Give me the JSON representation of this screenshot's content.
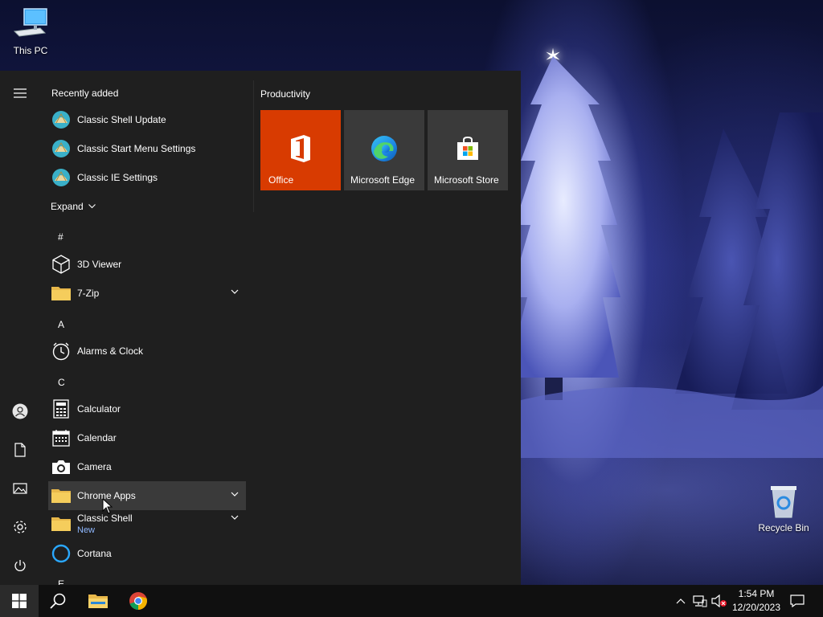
{
  "desktop": {
    "icons": [
      {
        "label": "This PC",
        "icon": "computer-icon"
      },
      {
        "label": "Recycle Bin",
        "icon": "recycle-bin-icon"
      }
    ]
  },
  "start_menu": {
    "recently_added_heading": "Recently added",
    "recently_added": [
      {
        "label": "Classic Shell Update",
        "icon": "classic-shell-icon"
      },
      {
        "label": "Classic Start Menu Settings",
        "icon": "classic-shell-icon"
      },
      {
        "label": "Classic IE Settings",
        "icon": "classic-shell-icon"
      }
    ],
    "expand_label": "Expand",
    "groups": [
      {
        "letter": "#",
        "apps": [
          {
            "label": "3D Viewer",
            "icon": "3d-viewer-icon",
            "folder": false
          },
          {
            "label": "7-Zip",
            "icon": "folder-icon",
            "folder": true
          }
        ]
      },
      {
        "letter": "A",
        "apps": [
          {
            "label": "Alarms & Clock",
            "icon": "alarm-clock-icon",
            "folder": false
          }
        ]
      },
      {
        "letter": "C",
        "apps": [
          {
            "label": "Calculator",
            "icon": "calculator-icon",
            "folder": false
          },
          {
            "label": "Calendar",
            "icon": "calendar-icon",
            "folder": false
          },
          {
            "label": "Camera",
            "icon": "camera-icon",
            "folder": false
          },
          {
            "label": "Chrome Apps",
            "icon": "folder-icon",
            "folder": true
          },
          {
            "label": "Classic Shell",
            "sub": "New",
            "icon": "folder-icon",
            "folder": true
          },
          {
            "label": "Cortana",
            "icon": "cortana-icon",
            "folder": false
          }
        ]
      },
      {
        "letter": "E",
        "apps": []
      }
    ],
    "tiles_heading": "Productivity",
    "tiles": [
      {
        "label": "Office",
        "icon": "office-icon",
        "color": "#d83b01"
      },
      {
        "label": "Microsoft Edge",
        "icon": "edge-icon",
        "color": "#3a3a3a"
      },
      {
        "label": "Microsoft Store",
        "icon": "store-icon",
        "color": "#3a3a3a"
      }
    ],
    "rail": [
      "hamburger-icon",
      "user-icon",
      "documents-icon",
      "pictures-icon",
      "settings-icon",
      "power-icon"
    ]
  },
  "taskbar": {
    "pinned": [
      "start-icon",
      "search-icon",
      "file-explorer-icon",
      "chrome-icon"
    ],
    "tray": [
      "chevron-up-icon",
      "network-icon",
      "volume-muted-icon"
    ],
    "time": "1:54 PM",
    "date": "12/20/2023",
    "notification_icon": "action-center-icon"
  },
  "colors": {
    "start_bg": "#1f1f1f",
    "taskbar_bg": "#101010",
    "office_tile": "#d83b01",
    "tile_bg": "#3a3a3a",
    "new_badge": "#8fb8ff"
  }
}
